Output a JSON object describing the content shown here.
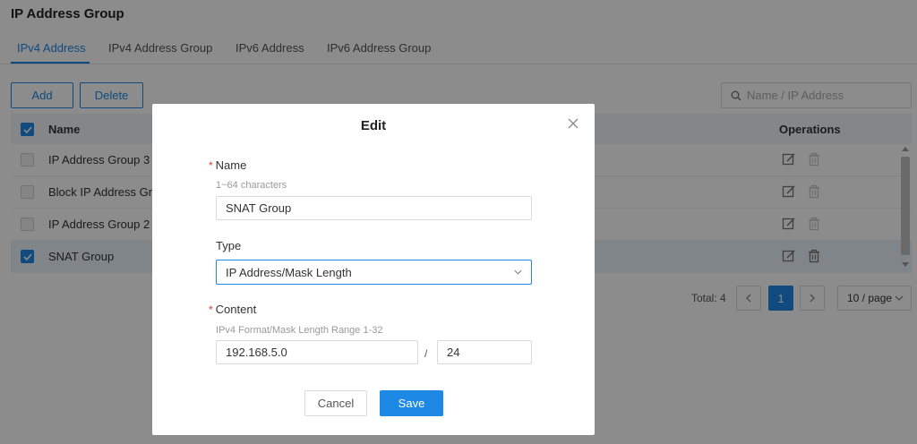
{
  "page": {
    "title": "IP Address Group"
  },
  "tabs": [
    {
      "label": "IPv4 Address",
      "active": true
    },
    {
      "label": "IPv4 Address Group",
      "active": false
    },
    {
      "label": "IPv6 Address",
      "active": false
    },
    {
      "label": "IPv6 Address Group",
      "active": false
    }
  ],
  "toolbar": {
    "add_label": "Add",
    "delete_label": "Delete"
  },
  "search": {
    "placeholder": "Name / IP Address",
    "icon": "search-icon"
  },
  "table": {
    "columns": {
      "name": "Name",
      "operations": "Operations"
    },
    "rows": [
      {
        "name": "IP Address Group 3",
        "checked": false
      },
      {
        "name": "Block IP Address Gro...",
        "checked": false
      },
      {
        "name": "IP Address Group 2",
        "checked": false
      },
      {
        "name": "SNAT Group",
        "checked": true
      }
    ]
  },
  "pagination": {
    "total": "Total: 4",
    "current_page": "1",
    "page_size": "10 / page"
  },
  "modal": {
    "title": "Edit",
    "name_label": "Name",
    "name_hint": "1~64 characters",
    "name_value": "SNAT Group",
    "type_label": "Type",
    "type_value": "IP Address/Mask Length",
    "content_label": "Content",
    "content_hint": "IPv4 Format/Mask Length Range 1-32",
    "ip_value": "192.168.5.0",
    "separator": "/",
    "mask_value": "24",
    "cancel_label": "Cancel",
    "save_label": "Save"
  },
  "colors": {
    "accent": "#1e88e5",
    "required": "#e53935"
  }
}
